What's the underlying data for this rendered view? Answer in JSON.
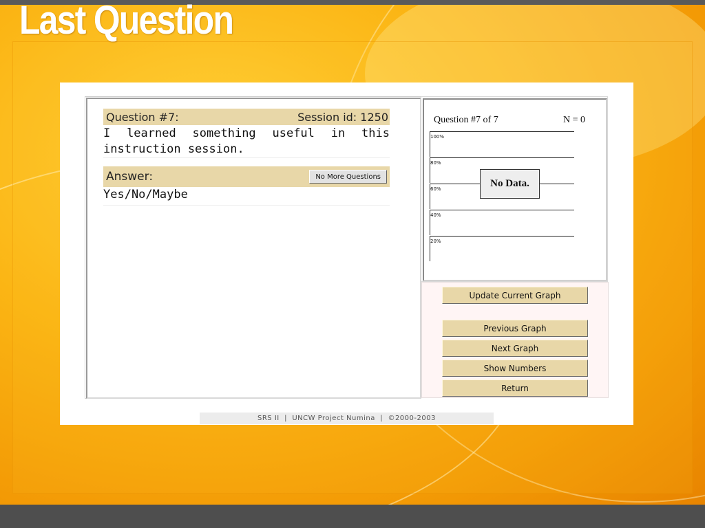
{
  "slide": {
    "title": "Last Question"
  },
  "question": {
    "header": "Question #7:",
    "session": "Session id: 1250",
    "text": "I learned something useful in this instruction session."
  },
  "answer": {
    "header": "Answer:",
    "no_more_label": "No More Questions",
    "text": "Yes/No/Maybe"
  },
  "graph": {
    "title": "Question #7 of 7",
    "n_label": "N = 0",
    "no_data": "No Data.",
    "y_ticks": [
      "100%",
      "80%",
      "60%",
      "40%",
      "20%"
    ]
  },
  "buttons": {
    "update": "Update Current Graph",
    "previous": "Previous Graph",
    "next": "Next Graph",
    "numbers": "Show Numbers",
    "return": "Return"
  },
  "footer": {
    "text": "SRS II  |  UNCW Project Numina  |  ©2000-2003"
  },
  "colors": {
    "accent": "#e8d7a8",
    "background": "#f5a90a"
  }
}
